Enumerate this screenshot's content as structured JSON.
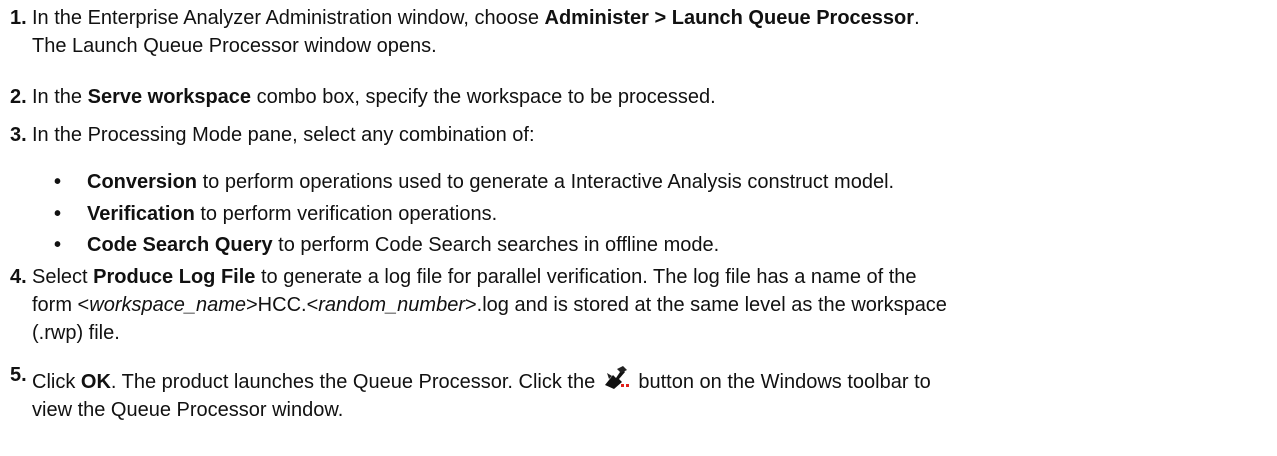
{
  "steps": [
    {
      "num": "1.",
      "pre": "In the Enterprise Analyzer Administration window, choose ",
      "bold": "Administer > Launch Queue Processor",
      "post": ".",
      "line2": "The Launch Queue Processor window opens."
    },
    {
      "num": "2.",
      "pre": "In the ",
      "bold": "Serve workspace",
      "post": " combo box, specify the workspace to be processed."
    },
    {
      "num": "3.",
      "text": "In the Processing Mode pane, select any combination of:",
      "bullets": [
        {
          "mark": "•",
          "bold": "Conversion",
          "text": " to perform operations used to generate a Interactive Analysis construct model."
        },
        {
          "mark": "•",
          "bold": "Verification",
          "text": " to perform verification operations."
        },
        {
          "mark": "•",
          "bold": "Code Search Query",
          "text": " to perform Code Search searches in offline mode."
        }
      ]
    },
    {
      "num": "4.",
      "pre": "Select ",
      "bold": "Produce Log File",
      "post": " to generate a log file for parallel verification. The log file has a name of the",
      "l2_a": "form <",
      "l2_i1": "workspace_name",
      "l2_b": ">HCC.<",
      "l2_i2": "random_number",
      "l2_c": ">.log and is stored at the same level as the workspace",
      "l3": "(.rwp) file."
    },
    {
      "num": "5.",
      "pre": "Click ",
      "bold": "OK",
      "mid": ". The product launches the Queue Processor. Click the ",
      "post": " button on the Windows toolbar to",
      "line2": "view the Queue Processor window.",
      "icon": "queue-processor-icon"
    }
  ]
}
